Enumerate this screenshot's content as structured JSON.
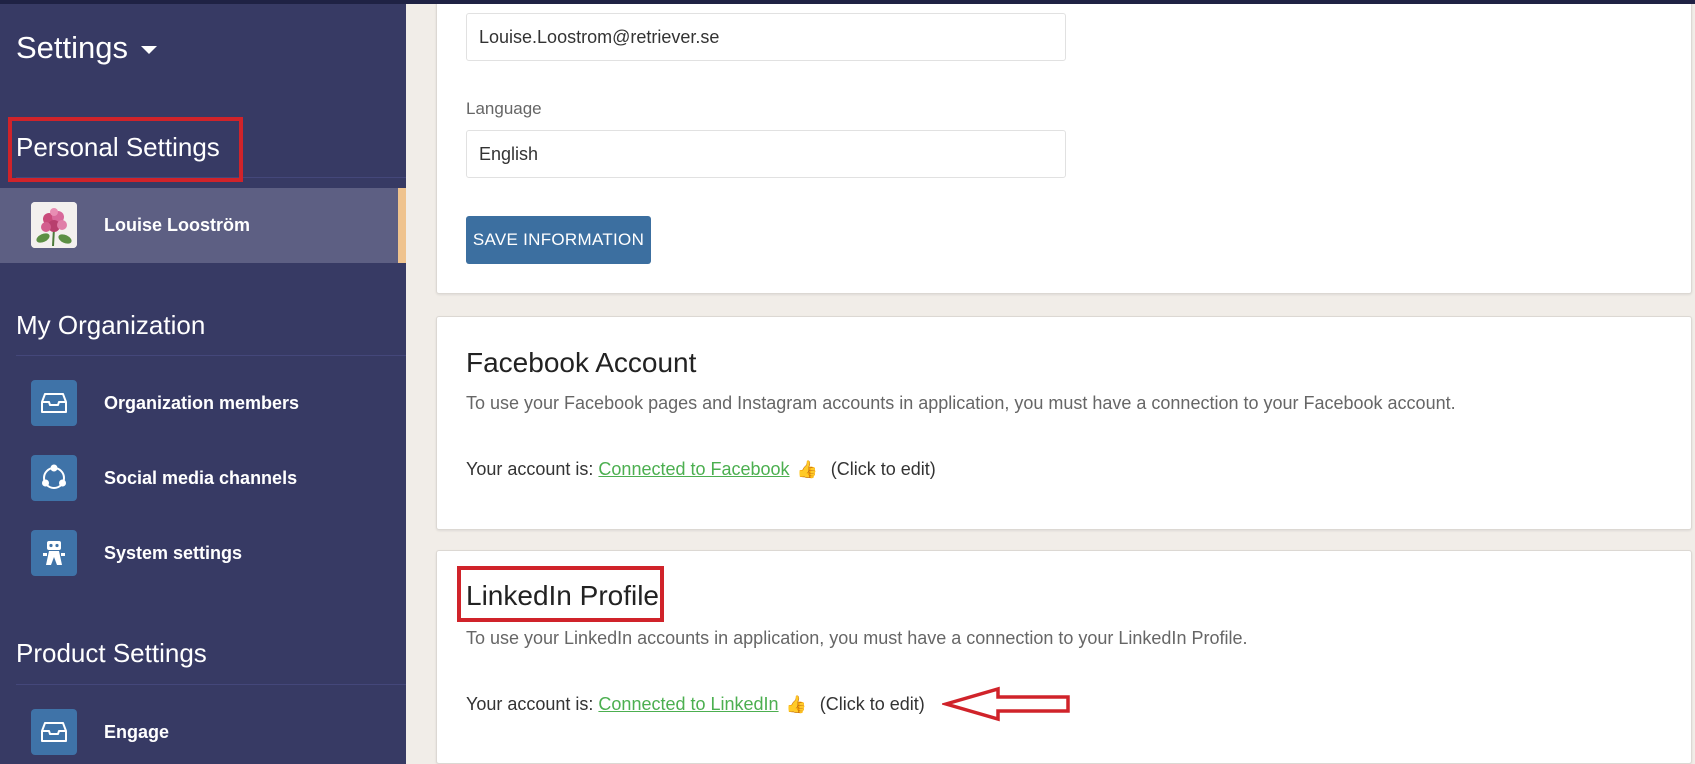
{
  "sidebar": {
    "title": "Settings",
    "personal_heading": "Personal Settings",
    "user_name": "Louise Looström",
    "org_heading": "My Organization",
    "org_items": [
      {
        "label": "Organization members",
        "icon": "inbox-tray-icon"
      },
      {
        "label": "Social media channels",
        "icon": "share-nodes-icon"
      },
      {
        "label": "System settings",
        "icon": "robot-icon"
      }
    ],
    "product_heading": "Product Settings",
    "product_items": [
      {
        "label": "Engage",
        "icon": "inbox-tray-icon"
      }
    ]
  },
  "profile": {
    "email_value": "Louise.Loostrom@retriever.se",
    "language_label": "Language",
    "language_value": "English",
    "save_label": "SAVE INFORMATION"
  },
  "facebook": {
    "title": "Facebook Account",
    "description": "To use your Facebook pages and Instagram accounts in application, you must have a connection to your Facebook account.",
    "status_prefix": "Your account is: ",
    "status_link": "Connected to Facebook",
    "edit_hint": "(Click to edit)"
  },
  "linkedin": {
    "title": "LinkedIn Profile",
    "description": "To use your LinkedIn accounts in application, you must have a connection to your LinkedIn Profile.",
    "status_prefix": "Your account is: ",
    "status_link": "Connected to LinkedIn",
    "edit_hint": "(Click to edit)"
  },
  "colors": {
    "sidebar_bg": "#373a64",
    "active_item_bg": "#5d5f83",
    "active_accent": "#efc38e",
    "icon_tile": "#3f73a8",
    "primary_button": "#3c6fa0",
    "link_green": "#4caf50",
    "annotation_red": "#d0232a",
    "page_bg": "#f1ede8"
  }
}
